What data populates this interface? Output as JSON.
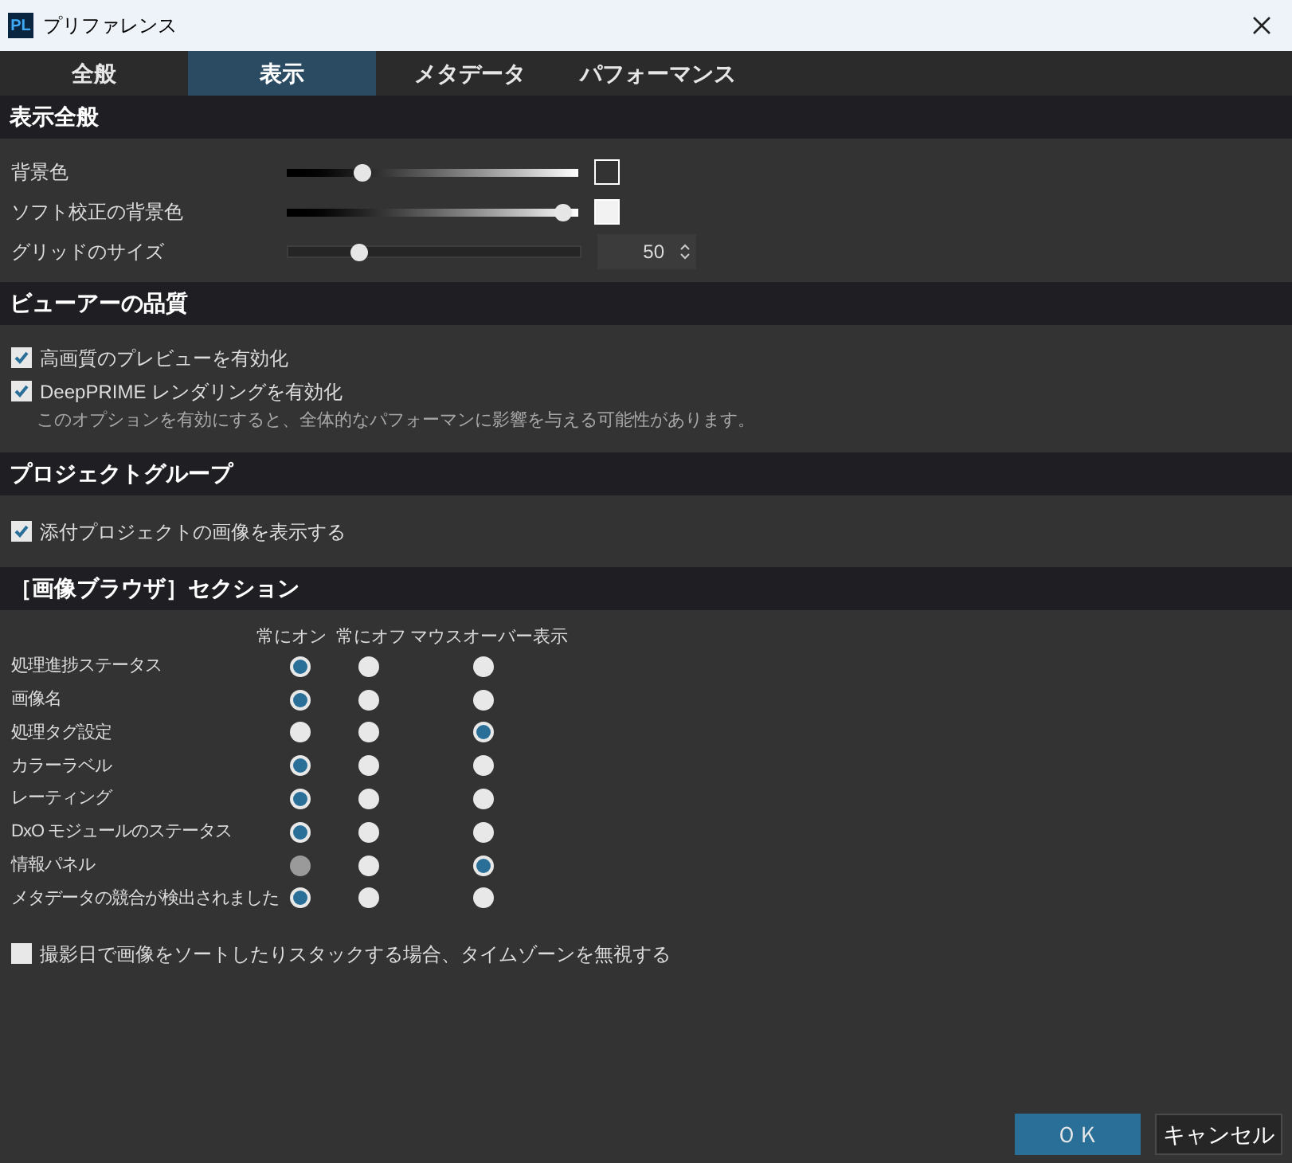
{
  "window": {
    "title": "プリファレンス",
    "app_badge": "PL"
  },
  "tabs": [
    {
      "label": "全般",
      "selected": false
    },
    {
      "label": "表示",
      "selected": true
    },
    {
      "label": "メタデータ",
      "selected": false
    },
    {
      "label": "パフォーマンス",
      "selected": false
    }
  ],
  "display_general": {
    "title": "表示全般",
    "sliders": [
      {
        "label": "背景色",
        "kind": "gradient",
        "level": 0.24,
        "color": "#333333"
      },
      {
        "label": "ソフト校正の背景色",
        "kind": "gradient",
        "level": 0.98,
        "color": "#f2f2f2"
      },
      {
        "label": "グリッドのサイズ",
        "kind": "spin",
        "level": 0.23,
        "value": "50"
      }
    ]
  },
  "viewer_quality": {
    "title": "ビューアーの品質",
    "options": [
      {
        "label": "高画質のプレビューを有効化",
        "checked": true
      },
      {
        "label": "DeepPRIME レンダリングを有効化",
        "checked": true,
        "note": "このオプションを有効にすると、全体的なパフォーマンに影響を与える可能性があります。"
      }
    ]
  },
  "project_group": {
    "title": "プロジェクトグループ",
    "options": [
      {
        "label": "添付プロジェクトの画像を表示する",
        "checked": true
      }
    ]
  },
  "browser_section": {
    "title": "［画像ブラウザ］セクション",
    "columns": [
      "常にオン",
      "常にオフ",
      "マウスオーバー表示"
    ],
    "rows": [
      {
        "label": "処理進捗ステータス",
        "options": [
          {
            "selected": true,
            "disabled": false
          },
          {
            "selected": false,
            "disabled": false
          },
          {
            "selected": false,
            "disabled": false
          }
        ]
      },
      {
        "label": "画像名",
        "options": [
          {
            "selected": true,
            "disabled": false
          },
          {
            "selected": false,
            "disabled": false
          },
          {
            "selected": false,
            "disabled": false
          }
        ]
      },
      {
        "label": "処理タグ設定",
        "options": [
          {
            "selected": false,
            "disabled": false
          },
          {
            "selected": false,
            "disabled": false
          },
          {
            "selected": true,
            "disabled": false
          }
        ]
      },
      {
        "label": "カラーラベル",
        "options": [
          {
            "selected": true,
            "disabled": false
          },
          {
            "selected": false,
            "disabled": false
          },
          {
            "selected": false,
            "disabled": false
          }
        ]
      },
      {
        "label": "レーティング",
        "options": [
          {
            "selected": true,
            "disabled": false
          },
          {
            "selected": false,
            "disabled": false
          },
          {
            "selected": false,
            "disabled": false
          }
        ]
      },
      {
        "label": "DxO モジュールのステータス",
        "options": [
          {
            "selected": true,
            "disabled": false
          },
          {
            "selected": false,
            "disabled": false
          },
          {
            "selected": false,
            "disabled": false
          }
        ]
      },
      {
        "label": "情報パネル",
        "options": [
          {
            "selected": false,
            "disabled": true
          },
          {
            "selected": false,
            "disabled": false
          },
          {
            "selected": true,
            "disabled": false
          }
        ]
      },
      {
        "label": "メタデータの競合が検出されました",
        "options": [
          {
            "selected": true,
            "disabled": false
          },
          {
            "selected": false,
            "disabled": false
          },
          {
            "selected": false,
            "disabled": false
          }
        ]
      }
    ],
    "timezone_option": {
      "label": "撮影日で画像をソートしたりスタックする場合、タイムゾーンを無視する",
      "checked": false
    }
  },
  "buttons": [
    {
      "label": "ＯＫ",
      "primary": true
    },
    {
      "label": "キャンセル",
      "primary": false
    }
  ]
}
